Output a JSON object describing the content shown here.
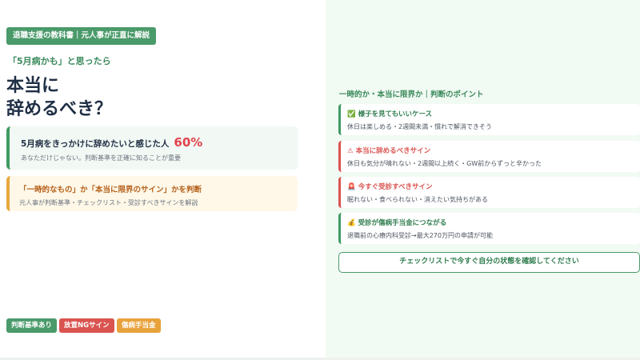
{
  "left": {
    "tag": "退職支援の教科書｜元人事が正直に解説",
    "lead": "「5月病かも」と思ったら",
    "headline_line1": "本当に",
    "headline_line2": "辞めるべき？",
    "card1": {
      "title": "5月病をきっかけに辞めたいと感じた人",
      "percent": "60%",
      "sub": "あなただけじゃない。判断基準を正確に知ることが重要"
    },
    "card2": {
      "title": "「一時的なもの」か「本当に限界のサイン」かを判断",
      "sub": "元人事が判断基準・チェックリスト・受診すべきサインを解説"
    },
    "badges": [
      "判断基準あり",
      "放置NGサイン",
      "傷病手当金"
    ]
  },
  "right": {
    "title": "一時的か・本当に限界か｜判断のポイント",
    "items": [
      {
        "icon": "✅",
        "heading": "様子を見てもいいケース",
        "desc": "休日は楽しめる・2週間未満・慣れで解消できそう"
      },
      {
        "icon": "⚠",
        "heading": "本当に辞めるべきサイン",
        "desc": "休日も気分が晴れない・2週間以上続く・GW前からずっと辛かった"
      },
      {
        "icon": "🚨",
        "heading": "今すぐ受診すべきサイン",
        "desc": "眠れない・食べられない・消えたい気持ちがある"
      },
      {
        "icon": "💰",
        "heading": "受診が傷病手当金につながる",
        "desc": "退職前の心療内科受診→最大270万円の申請が可能"
      }
    ],
    "cta": "チェックリストで今すぐ自分の状態を確認してください"
  }
}
